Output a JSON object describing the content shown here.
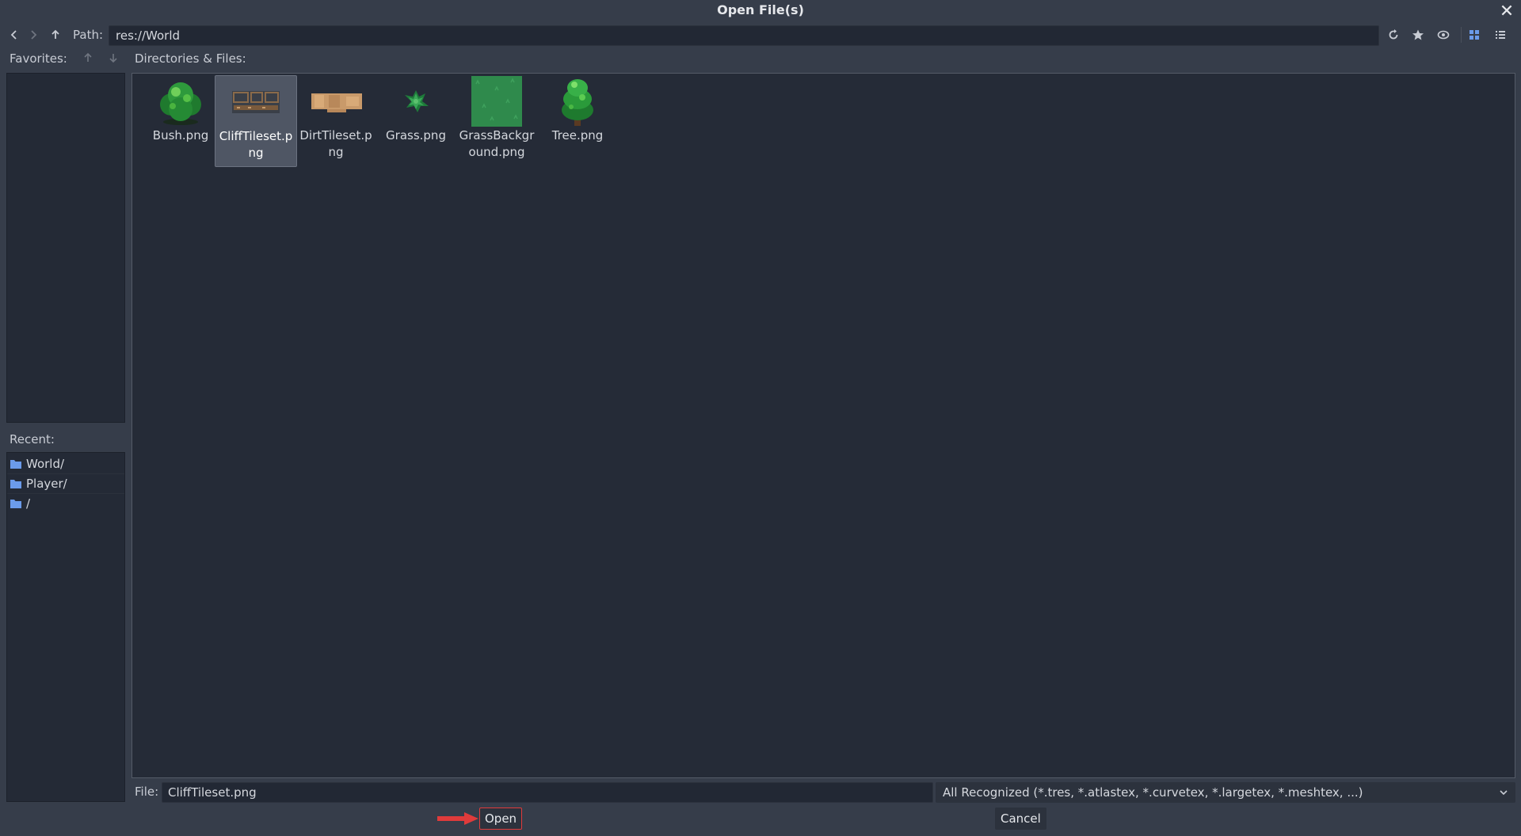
{
  "window": {
    "title": "Open File(s)"
  },
  "toolbar": {
    "path_label": "Path:",
    "path_value": "res://World"
  },
  "favorites": {
    "label": "Favorites:"
  },
  "files": {
    "label": "Directories & Files:",
    "items": [
      {
        "name": "Bush.png",
        "selected": false
      },
      {
        "name": "CliffTileset.png",
        "selected": true
      },
      {
        "name": "DirtTileset.png",
        "selected": false
      },
      {
        "name": "Grass.png",
        "selected": false
      },
      {
        "name": "GrassBackground.png",
        "selected": false
      },
      {
        "name": "Tree.png",
        "selected": false
      }
    ]
  },
  "recent": {
    "label": "Recent:",
    "items": [
      "World/",
      "Player/",
      "/"
    ]
  },
  "footer": {
    "file_label": "File:",
    "file_value": "CliffTileset.png",
    "filter": "All Recognized (*.tres, *.atlastex, *.curvetex, *.largetex, *.meshtex, ...)",
    "open_label": "Open",
    "cancel_label": "Cancel"
  },
  "colors": {
    "accent": "#6b9bea",
    "highlight": "#e03b3b",
    "background": "#363d4a"
  }
}
